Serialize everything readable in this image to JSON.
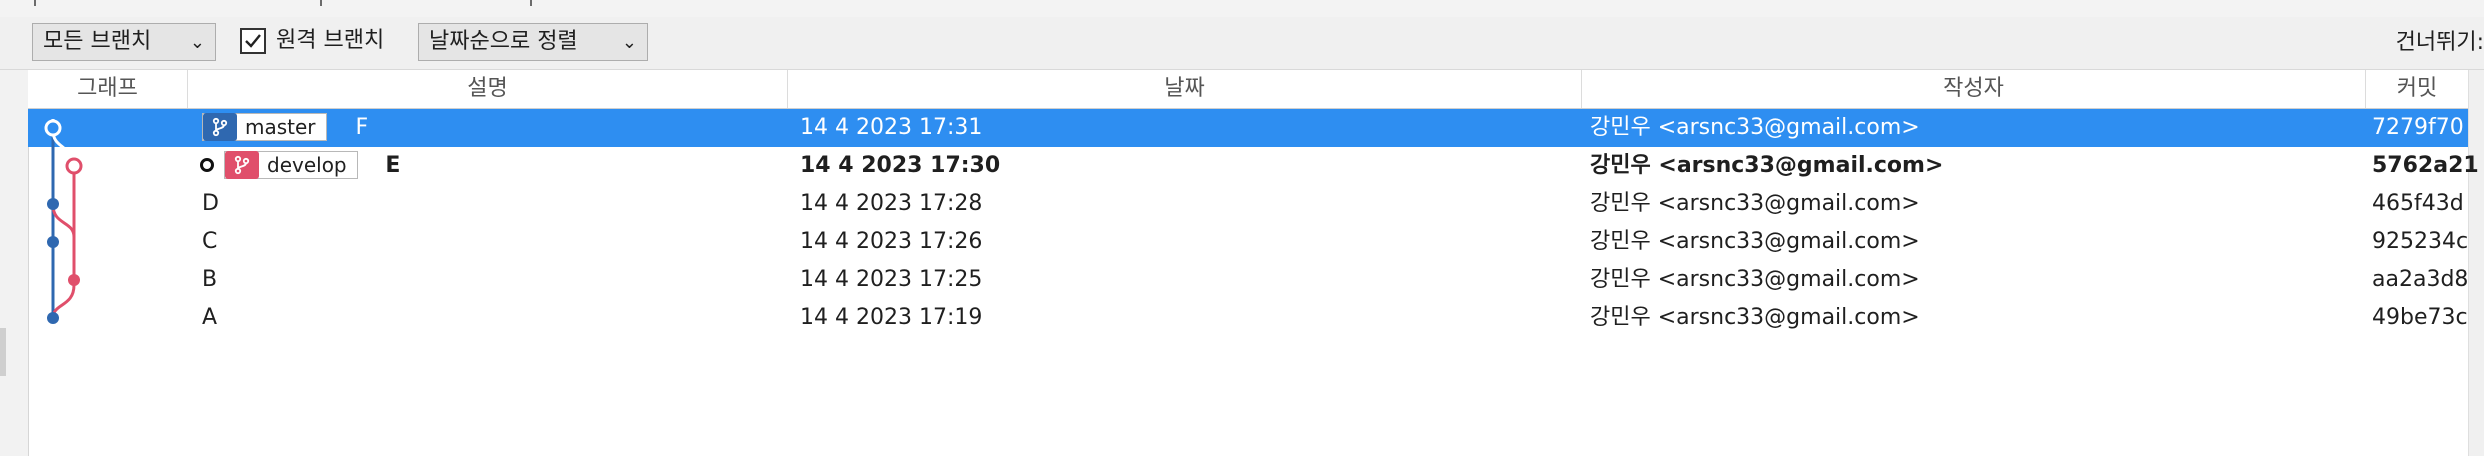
{
  "toolbar": {
    "branch_filter": "모든 브랜치",
    "remote_branches_label": "원격 브랜치",
    "remote_branches_checked": true,
    "sort": "날짜순으로 정렬",
    "skip_label": "건너뛰기:"
  },
  "columns": {
    "graph": "그래프",
    "description": "설명",
    "date": "날짜",
    "author": "작성자",
    "commit": "커밋"
  },
  "colors": {
    "selection": "#2e8ef1",
    "master_lane": "#2f68b0",
    "develop_lane": "#e04f6b"
  },
  "commits": [
    {
      "message": "F",
      "branch": "master",
      "date": "14 4 2023 17:31",
      "author": "강민우 <arsnc33@gmail.com>",
      "hash": "7279f70",
      "selected": true,
      "bold": false,
      "head": false
    },
    {
      "message": "E",
      "branch": "develop",
      "date": "14 4 2023 17:30",
      "author": "강민우 <arsnc33@gmail.com>",
      "hash": "5762a21",
      "selected": false,
      "bold": true,
      "head": true
    },
    {
      "message": "D",
      "branch": "",
      "date": "14 4 2023 17:28",
      "author": "강민우 <arsnc33@gmail.com>",
      "hash": "465f43d",
      "selected": false,
      "bold": false,
      "head": false
    },
    {
      "message": "C",
      "branch": "",
      "date": "14 4 2023 17:26",
      "author": "강민우 <arsnc33@gmail.com>",
      "hash": "925234c",
      "selected": false,
      "bold": false,
      "head": false
    },
    {
      "message": "B",
      "branch": "",
      "date": "14 4 2023 17:25",
      "author": "강민우 <arsnc33@gmail.com>",
      "hash": "aa2a3d8",
      "selected": false,
      "bold": false,
      "head": false
    },
    {
      "message": "A",
      "branch": "",
      "date": "14 4 2023 17:19",
      "author": "강민우 <arsnc33@gmail.com>",
      "hash": "49be73c",
      "selected": false,
      "bold": false,
      "head": false
    }
  ]
}
